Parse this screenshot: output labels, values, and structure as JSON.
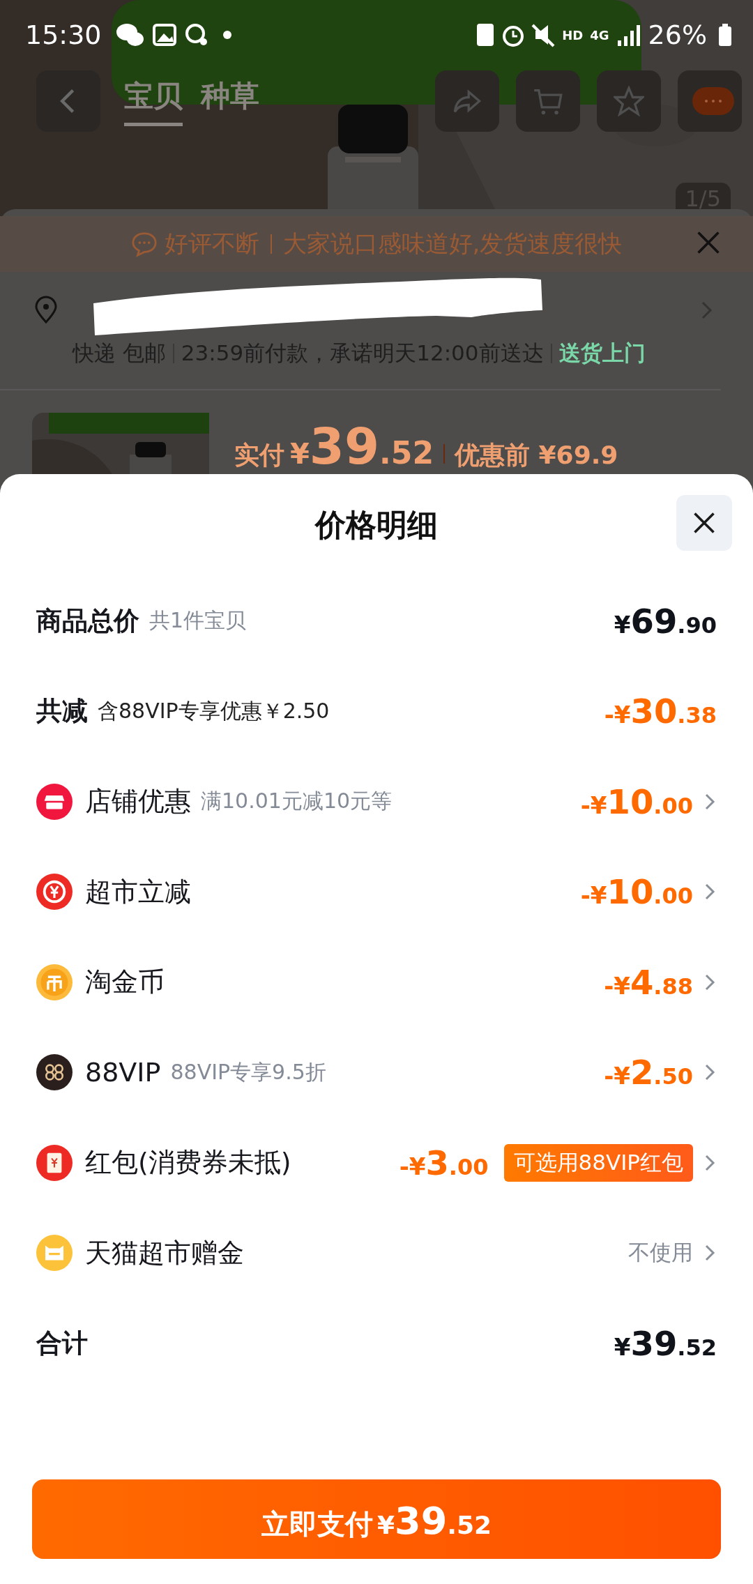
{
  "status_bar": {
    "time": "15:30",
    "battery": "26%",
    "hd": "HD",
    "network": "4G"
  },
  "nav": {
    "tabs": [
      {
        "label": "宝贝",
        "selected": true
      },
      {
        "label": "种草",
        "selected": false
      }
    ]
  },
  "gallery": {
    "counter": "1/5"
  },
  "order_sheet": {
    "review_tag": "好评不断",
    "review_text": "大家说口感味道好,发货速度很快",
    "delivery": {
      "method": "快递 包邮",
      "promise": "23:59前付款，承诺明天12:00前送达",
      "service": "送货上门"
    },
    "price": {
      "paid_label": "实付",
      "currency": "¥",
      "integer": "39",
      "decimal": ".52",
      "before_label": "优惠前",
      "before_price": "¥69.9"
    }
  },
  "price_detail": {
    "title": "价格明细",
    "rows": [
      {
        "kind": "subtotal",
        "label": "商品总价",
        "note": "共1件宝贝",
        "prefix": "¥",
        "integer": "69",
        "decimal": ".90",
        "arrow": false
      },
      {
        "kind": "reduction",
        "label": "共减",
        "note": "含88VIP专享优惠￥2.50",
        "prefix": "-¥",
        "integer": "30",
        "decimal": ".38",
        "arrow": false
      },
      {
        "kind": "store",
        "label": "店铺优惠",
        "note": "满10.01元减10元等",
        "prefix": "-¥",
        "integer": "10",
        "decimal": ".00",
        "arrow": true
      },
      {
        "kind": "instant",
        "label": "超市立减",
        "prefix": "-¥",
        "integer": "10",
        "decimal": ".00",
        "arrow": true
      },
      {
        "kind": "coins",
        "label": "淘金币",
        "prefix": "-¥",
        "integer": "4",
        "decimal": ".88",
        "arrow": true
      },
      {
        "kind": "vip",
        "label": "88VIP",
        "note": "88VIP专享9.5折",
        "prefix": "-¥",
        "integer": "2",
        "decimal": ".50",
        "arrow": true
      },
      {
        "kind": "red_packet",
        "label": "红包(消费券未抵)",
        "prefix": "-¥",
        "integer": "3",
        "decimal": ".00",
        "badge": "可选用88VIP红包",
        "arrow": true
      },
      {
        "kind": "gift",
        "label": "天猫超市赠金",
        "value": "不使用",
        "arrow": true
      },
      {
        "kind": "total",
        "label": "合计",
        "prefix": "¥",
        "integer": "39",
        "decimal": ".52",
        "arrow": false
      }
    ],
    "pay_button": {
      "label": "立即支付",
      "prefix": "¥",
      "integer": "39",
      "decimal": ".52"
    }
  }
}
